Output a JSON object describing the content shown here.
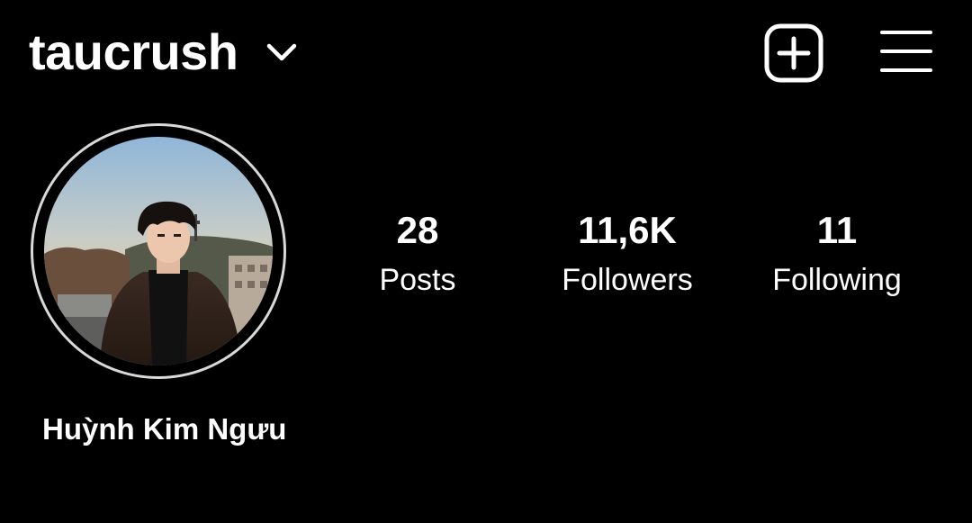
{
  "header": {
    "username": "taucrush",
    "switch_account_icon": "chevron-down-icon",
    "new_post_icon": "plus-square-icon",
    "menu_icon": "hamburger-menu-icon"
  },
  "profile": {
    "avatar_icon": "profile-photo",
    "display_name": "Huỳnh Kim Ngưu",
    "ring_color": "#d9d9d9"
  },
  "stats": [
    {
      "value": "28",
      "label": "Posts"
    },
    {
      "value": "11,6K",
      "label": "Followers"
    },
    {
      "value": "11",
      "label": "Following"
    }
  ],
  "theme": {
    "background": "#000000",
    "text": "#ffffff"
  }
}
